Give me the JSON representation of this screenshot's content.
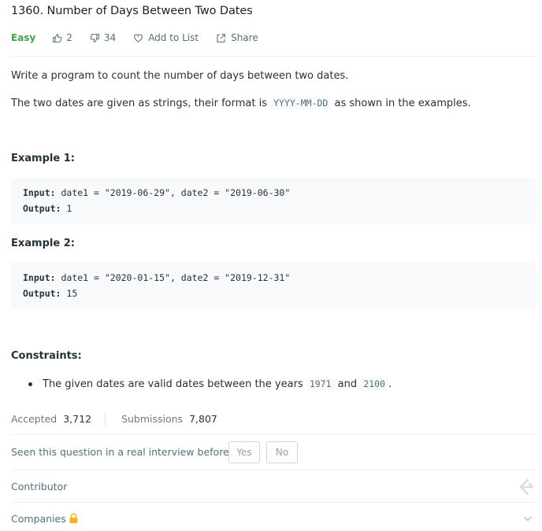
{
  "problem": {
    "title": "1360. Number of Days Between Two Dates",
    "difficulty": "Easy",
    "likes": "2",
    "dislikes": "34",
    "add_to_list": "Add to List",
    "share": "Share"
  },
  "description": {
    "p1": "Write a program to count the number of days between two dates.",
    "p2_before": "The two dates are given as strings, their format is ",
    "p2_code": "YYYY-MM-DD",
    "p2_after": " as shown in the examples."
  },
  "examples": [
    {
      "heading": "Example 1:",
      "input_label": "Input:",
      "input_value": " date1 = \"2019-06-29\", date2 = \"2019-06-30\"",
      "output_label": "Output:",
      "output_value": " 1"
    },
    {
      "heading": "Example 2:",
      "input_label": "Input:",
      "input_value": " date1 = \"2020-01-15\", date2 = \"2019-12-31\"",
      "output_label": "Output:",
      "output_value": " 15"
    }
  ],
  "constraints": {
    "heading": "Constraints:",
    "item_before": "The given dates are valid dates between the years ",
    "code1": "1971",
    "item_middle": " and ",
    "code2": "2100",
    "item_after": "."
  },
  "stats": {
    "accepted_label": "Accepted",
    "accepted_value": "3,712",
    "submissions_label": "Submissions",
    "submissions_value": "7,807"
  },
  "interview": {
    "question": "Seen this question in a real interview before?",
    "yes": "Yes",
    "no": "No"
  },
  "sections": {
    "contributor": "Contributor",
    "companies": "Companies"
  },
  "colors": {
    "easy": "#43a047",
    "lock": "#f0b429",
    "muted": "#546e7a"
  }
}
